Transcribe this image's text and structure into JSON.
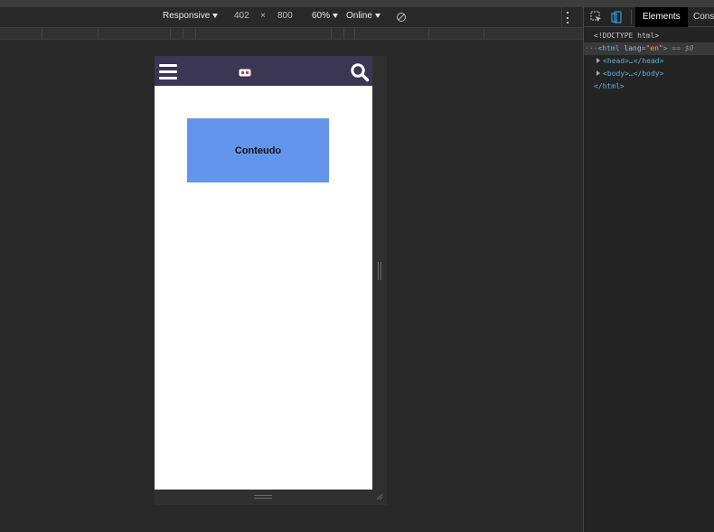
{
  "device_toolbar": {
    "device": "Responsive",
    "width": "402",
    "times": "×",
    "height": "800",
    "zoom": "60%",
    "throttle": "Online"
  },
  "site": {
    "content_label": "Conteudo",
    "navbar_color": "#3a3653",
    "content_color": "#6495ed"
  },
  "devtools": {
    "tabs": [
      "Elements",
      "Conso"
    ],
    "dom": {
      "doctype": "<!DOCTYPE html>",
      "prefix": "···",
      "html_open_tag": "<html",
      "lang_attr": "lang=",
      "lang_value": "\"en\"",
      "html_close_bracket": ">",
      "selected_marker": "== $0",
      "head": "<head>…</head>",
      "body": "<body>…</body>",
      "html_close": "</html>"
    }
  },
  "icons": {
    "menu": "hamburger-menu-icon",
    "logo": "logo-icon",
    "search": "search-icon",
    "rotate": "rotate-icon",
    "more": "kebab-menu-icon",
    "inspect": "inspect-element-icon",
    "device": "device-toggle-icon"
  }
}
